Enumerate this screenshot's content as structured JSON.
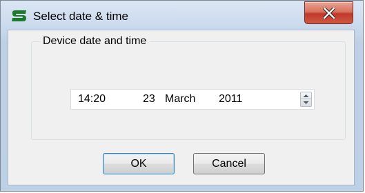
{
  "window": {
    "title": "Select date & time",
    "icon": "app-s-logo-icon",
    "close_icon": "close-x-icon"
  },
  "group": {
    "label": "Device date and time"
  },
  "datetime": {
    "time": "14:20",
    "day": "23",
    "month": "March",
    "year": "2011",
    "spinner_icon": "up-down-spinner-icon"
  },
  "buttons": {
    "ok_label": "OK",
    "cancel_label": "Cancel"
  },
  "colors": {
    "close_button": "#c94a35",
    "app_icon": "#1c7a2a"
  }
}
